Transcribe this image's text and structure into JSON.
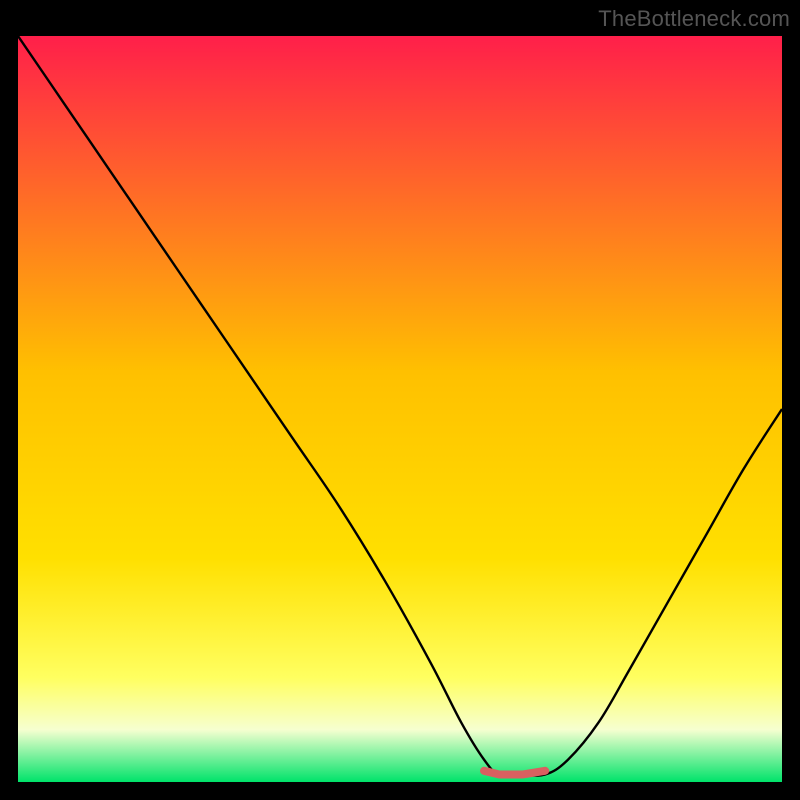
{
  "watermark": "TheBottleneck.com",
  "colors": {
    "frame": "#000000",
    "gradient_top": "#ff1f4a",
    "gradient_mid": "#ffd000",
    "gradient_yellow": "#ffff30",
    "gradient_pale": "#f8ffc8",
    "gradient_green": "#00e36a",
    "curve": "#000000",
    "marker_fill": "#d96060",
    "marker_stroke": "#b04848"
  },
  "chart_data": {
    "type": "line",
    "title": "",
    "xlabel": "",
    "ylabel": "",
    "xlim": [
      0,
      100
    ],
    "ylim": [
      0,
      100
    ],
    "grid": false,
    "legend": false,
    "annotations": [],
    "series": [
      {
        "name": "bottleneck-curve",
        "x": [
          0,
          6,
          12,
          18,
          24,
          30,
          36,
          42,
          48,
          54,
          58,
          61,
          63,
          66,
          69,
          72,
          76,
          80,
          85,
          90,
          95,
          100
        ],
        "values": [
          100,
          91,
          82,
          73,
          64,
          55,
          46,
          37,
          27,
          16,
          8,
          3,
          1,
          1,
          1,
          3,
          8,
          15,
          24,
          33,
          42,
          50
        ]
      },
      {
        "name": "optimal-range-marker",
        "x": [
          61,
          63,
          66,
          69
        ],
        "values": [
          1.5,
          1.0,
          1.0,
          1.5
        ]
      }
    ],
    "gradient_stops": [
      {
        "offset": 0.0,
        "color": "#ff1f4a"
      },
      {
        "offset": 0.45,
        "color": "#ffc000"
      },
      {
        "offset": 0.7,
        "color": "#ffe000"
      },
      {
        "offset": 0.86,
        "color": "#ffff60"
      },
      {
        "offset": 0.93,
        "color": "#f6ffd0"
      },
      {
        "offset": 1.0,
        "color": "#00e36a"
      }
    ]
  }
}
